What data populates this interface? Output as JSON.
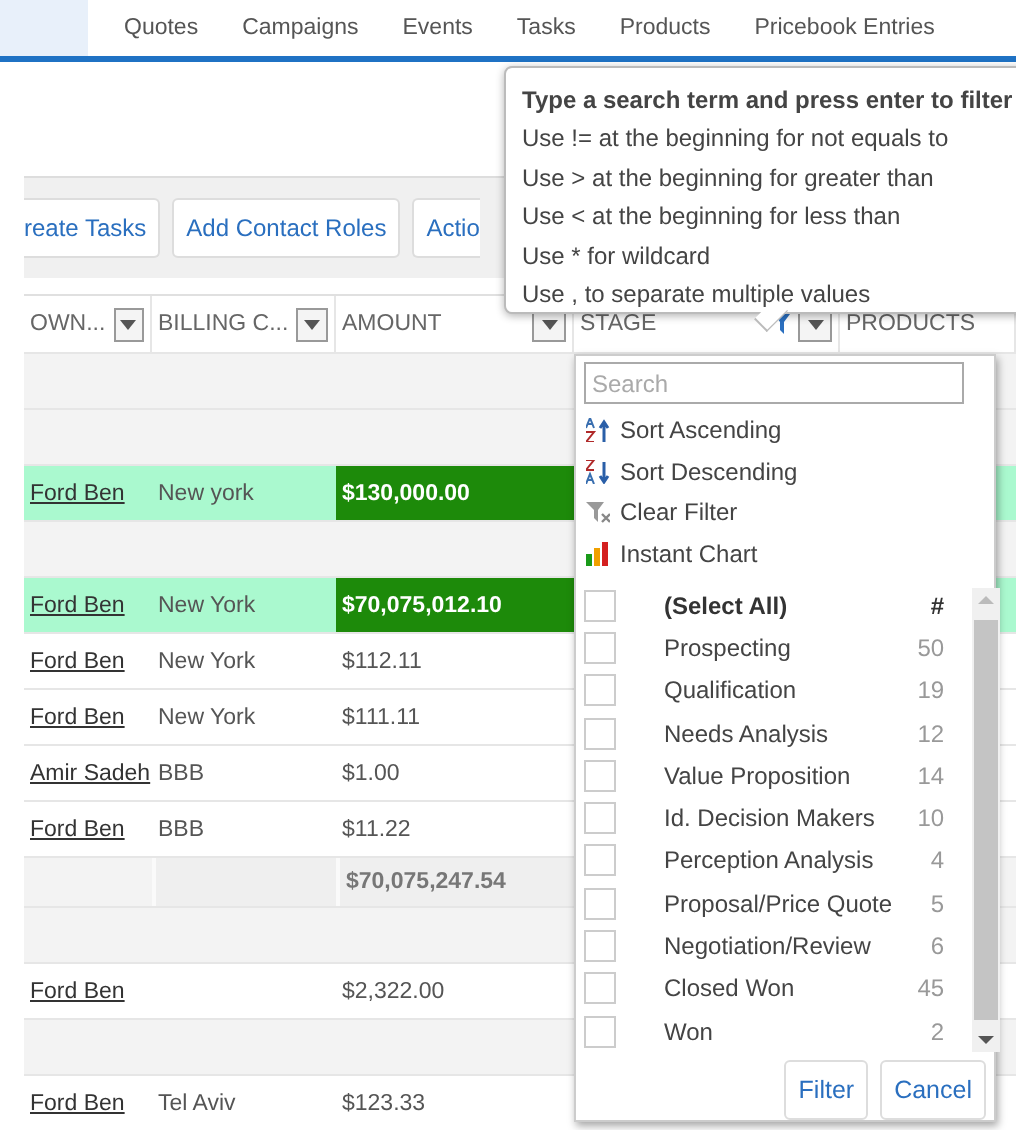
{
  "nav_tabs": [
    "Quotes",
    "Campaigns",
    "Events",
    "Tasks",
    "Products",
    "Pricebook Entries"
  ],
  "toolbar": {
    "buttons": [
      "reate Tasks",
      "Add Contact Roles",
      "Actio"
    ]
  },
  "table": {
    "columns": [
      {
        "label": "OWN...",
        "filter": true,
        "filtered": false
      },
      {
        "label": "BILLING C...",
        "filter": true,
        "filtered": false
      },
      {
        "label": "AMOUNT",
        "filter": true,
        "filtered": false
      },
      {
        "label": "STAGE",
        "filter": true,
        "filtered": true
      },
      {
        "label": "PRODUCTS",
        "filter": false,
        "filtered": false
      }
    ],
    "rows": [
      {
        "kind": "group"
      },
      {
        "kind": "group"
      },
      {
        "kind": "record",
        "highlighted": true,
        "owner": "Ford Ben",
        "billing": "New york",
        "amount": "$130,000.00"
      },
      {
        "kind": "group"
      },
      {
        "kind": "record",
        "highlighted": true,
        "owner": "Ford Ben",
        "billing": "New York",
        "amount": "$70,075,012.10"
      },
      {
        "kind": "record",
        "highlighted": false,
        "owner": "Ford Ben",
        "billing": "New York",
        "amount": "$112.11"
      },
      {
        "kind": "record",
        "highlighted": false,
        "owner": "Ford Ben",
        "billing": "New York",
        "amount": "$111.11"
      },
      {
        "kind": "record",
        "highlighted": false,
        "owner": "Amir Sadeh",
        "billing": "BBB",
        "amount": "$1.00"
      },
      {
        "kind": "record",
        "highlighted": false,
        "owner": "Ford Ben",
        "billing": "BBB",
        "amount": "$11.22"
      },
      {
        "kind": "subtotal",
        "amount": "$70,075,247.54"
      },
      {
        "kind": "group"
      },
      {
        "kind": "record",
        "highlighted": false,
        "owner": "Ford Ben",
        "amount": "$2,322.00"
      },
      {
        "kind": "group"
      },
      {
        "kind": "record",
        "highlighted": false,
        "owner": "Ford Ben",
        "billing": "Tel Aviv",
        "amount": "$123.33"
      }
    ]
  },
  "tooltip": {
    "title": "Type a search term and press enter to filter",
    "lines": [
      "Use != at the beginning for not equals to",
      "Use > at the beginning for greater than",
      "Use < at the beginning for less than",
      "Use * for wildcard",
      "Use , to separate multiple values"
    ]
  },
  "filter_menu": {
    "search": {
      "placeholder": "Search"
    },
    "actions": [
      {
        "kind": "sort-asc",
        "label": "Sort Ascending"
      },
      {
        "kind": "sort-desc",
        "label": "Sort Descending"
      },
      {
        "kind": "clear",
        "label": "Clear Filter"
      },
      {
        "kind": "chart",
        "label": "Instant Chart"
      }
    ],
    "select_all": {
      "label": "(Select All)",
      "count_heading": "#",
      "checked": false
    },
    "values": [
      {
        "label": "Prospecting",
        "count": "50",
        "checked": false
      },
      {
        "label": "Qualification",
        "count": "19",
        "checked": false
      },
      {
        "label": "Needs Analysis",
        "count": "12",
        "checked": false
      },
      {
        "label": "Value Proposition",
        "count": "14",
        "checked": false
      },
      {
        "label": "Id. Decision Makers",
        "count": "10",
        "checked": false
      },
      {
        "label": "Perception Analysis",
        "count": "4",
        "checked": false
      },
      {
        "label": "Proposal/Price Quote",
        "count": "5",
        "checked": false
      },
      {
        "label": "Negotiation/Review",
        "count": "6",
        "checked": false
      },
      {
        "label": "Closed Won",
        "count": "45",
        "checked": false
      },
      {
        "label": "Won",
        "count": "2",
        "checked": false
      }
    ],
    "buttons": [
      "Filter",
      "Cancel"
    ]
  }
}
